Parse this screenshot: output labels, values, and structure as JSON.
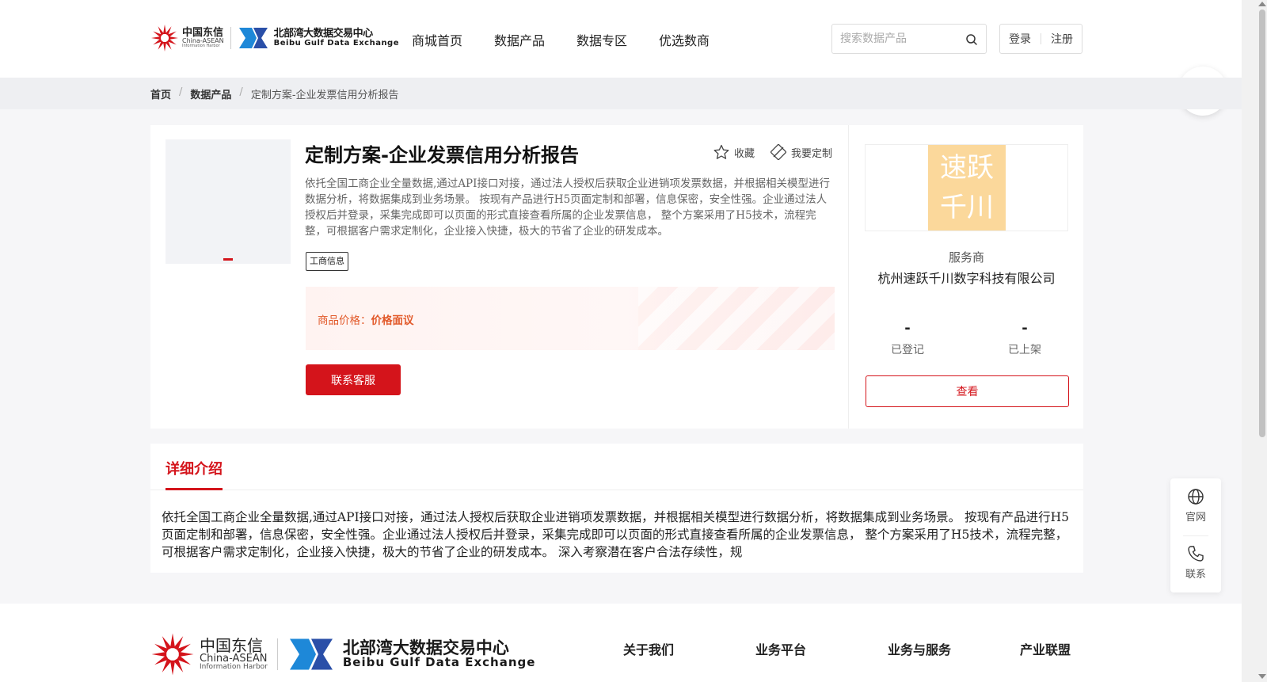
{
  "logo": {
    "ct_cn": "中国东信",
    "ct_en": "China-ASEAN",
    "ct_en2": "Information Harbor",
    "bb_cn": "北部湾大数据交易中心",
    "bb_en": "Beibu Gulf Data Exchange"
  },
  "nav": {
    "items": [
      "商城首页",
      "数据产品",
      "数据专区",
      "优选数商"
    ]
  },
  "search": {
    "placeholder": "搜索数据产品",
    "icon": "search-icon"
  },
  "auth": {
    "login": "登录",
    "register": "注册"
  },
  "breadcrumb": {
    "home": "首页",
    "category": "数据产品",
    "current": "定制方案-企业发票信用分析报告"
  },
  "product": {
    "title": "定制方案-企业发票信用分析报告",
    "favorite_label": "收藏",
    "customize_label": "我要定制",
    "description": "依托全国工商企业全量数据,通过API接口对接，通过法人授权后获取企业进销项发票数据，并根据相关模型进行数据分析，将数据集成到业务场景。 按现有产品进行H5页面定制和部署，信息保密，安全性强。企业通过法人授权后并登录，采集完成即可以页面的形式直接查看所属的企业发票信息， 整个方案采用了H5技术，流程完整，可根据客户需求定制化，企业接入快捷，极大的节省了企业的研发成本。",
    "tag": "工商信息",
    "price_label": "商品价格：",
    "price_value": "价格面议",
    "contact_button": "联系客服"
  },
  "provider": {
    "logo_line1": "速跃",
    "logo_line2": "千川",
    "label": "服务商",
    "name": "杭州速跃千川数字科技有限公司",
    "registered_value": "-",
    "registered_label": "已登记",
    "listed_value": "-",
    "listed_label": "已上架",
    "view_button": "查看"
  },
  "detail": {
    "tab_label": "详细介绍",
    "text": "依托全国工商企业全量数据,通过API接口对接，通过法人授权后获取企业进销项发票数据，并根据相关模型进行数据分析，将数据集成到业务场景。 按现有产品进行H5页面定制和部署，信息保密，安全性强。企业通过法人授权后并登录，采集完成即可以页面的形式直接查看所属的企业发票信息， 整个方案采用了H5技术，流程完整，可根据客户需求定制化，企业接入快捷，极大的节省了企业的研发成本。 深入考察潜在客户合法存续性，规"
  },
  "side_float": {
    "official_label": "官网",
    "contact_label": "联系"
  },
  "footer": {
    "nav": [
      "关于我们",
      "业务平台",
      "业务与服务",
      "产业联盟"
    ]
  },
  "colors": {
    "brand_red": "#d4141b",
    "price_orange": "#e25a2b",
    "provider_logo_bg": "#fbd89b"
  }
}
